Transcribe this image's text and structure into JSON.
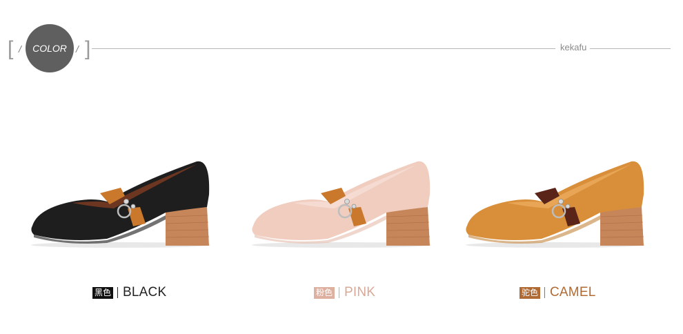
{
  "header": {
    "left_bracket": "[",
    "left_slash": "/",
    "badge_label": "COLOR",
    "right_slash": "/",
    "right_bracket": "]",
    "brand": "kekafu"
  },
  "products": [
    {
      "cn": "黑色",
      "en": "BLACK",
      "body_color": "#1e1e1e",
      "strap_color": "#c9782c",
      "heel_color": "#c7865a",
      "label_color": "#222222",
      "tag_color": "#111111"
    },
    {
      "cn": "粉色",
      "en": "PINK",
      "body_color": "#f0cdbf",
      "strap_color": "#c9782c",
      "heel_color": "#c7865a",
      "label_color": "#d8a896",
      "tag_color": "#deb09f"
    },
    {
      "cn": "驼色",
      "en": "CAMEL",
      "body_color": "#d98f3a",
      "strap_color": "#5a2418",
      "heel_color": "#c7865a",
      "label_color": "#b06b35",
      "tag_color": "#b06b35"
    }
  ]
}
